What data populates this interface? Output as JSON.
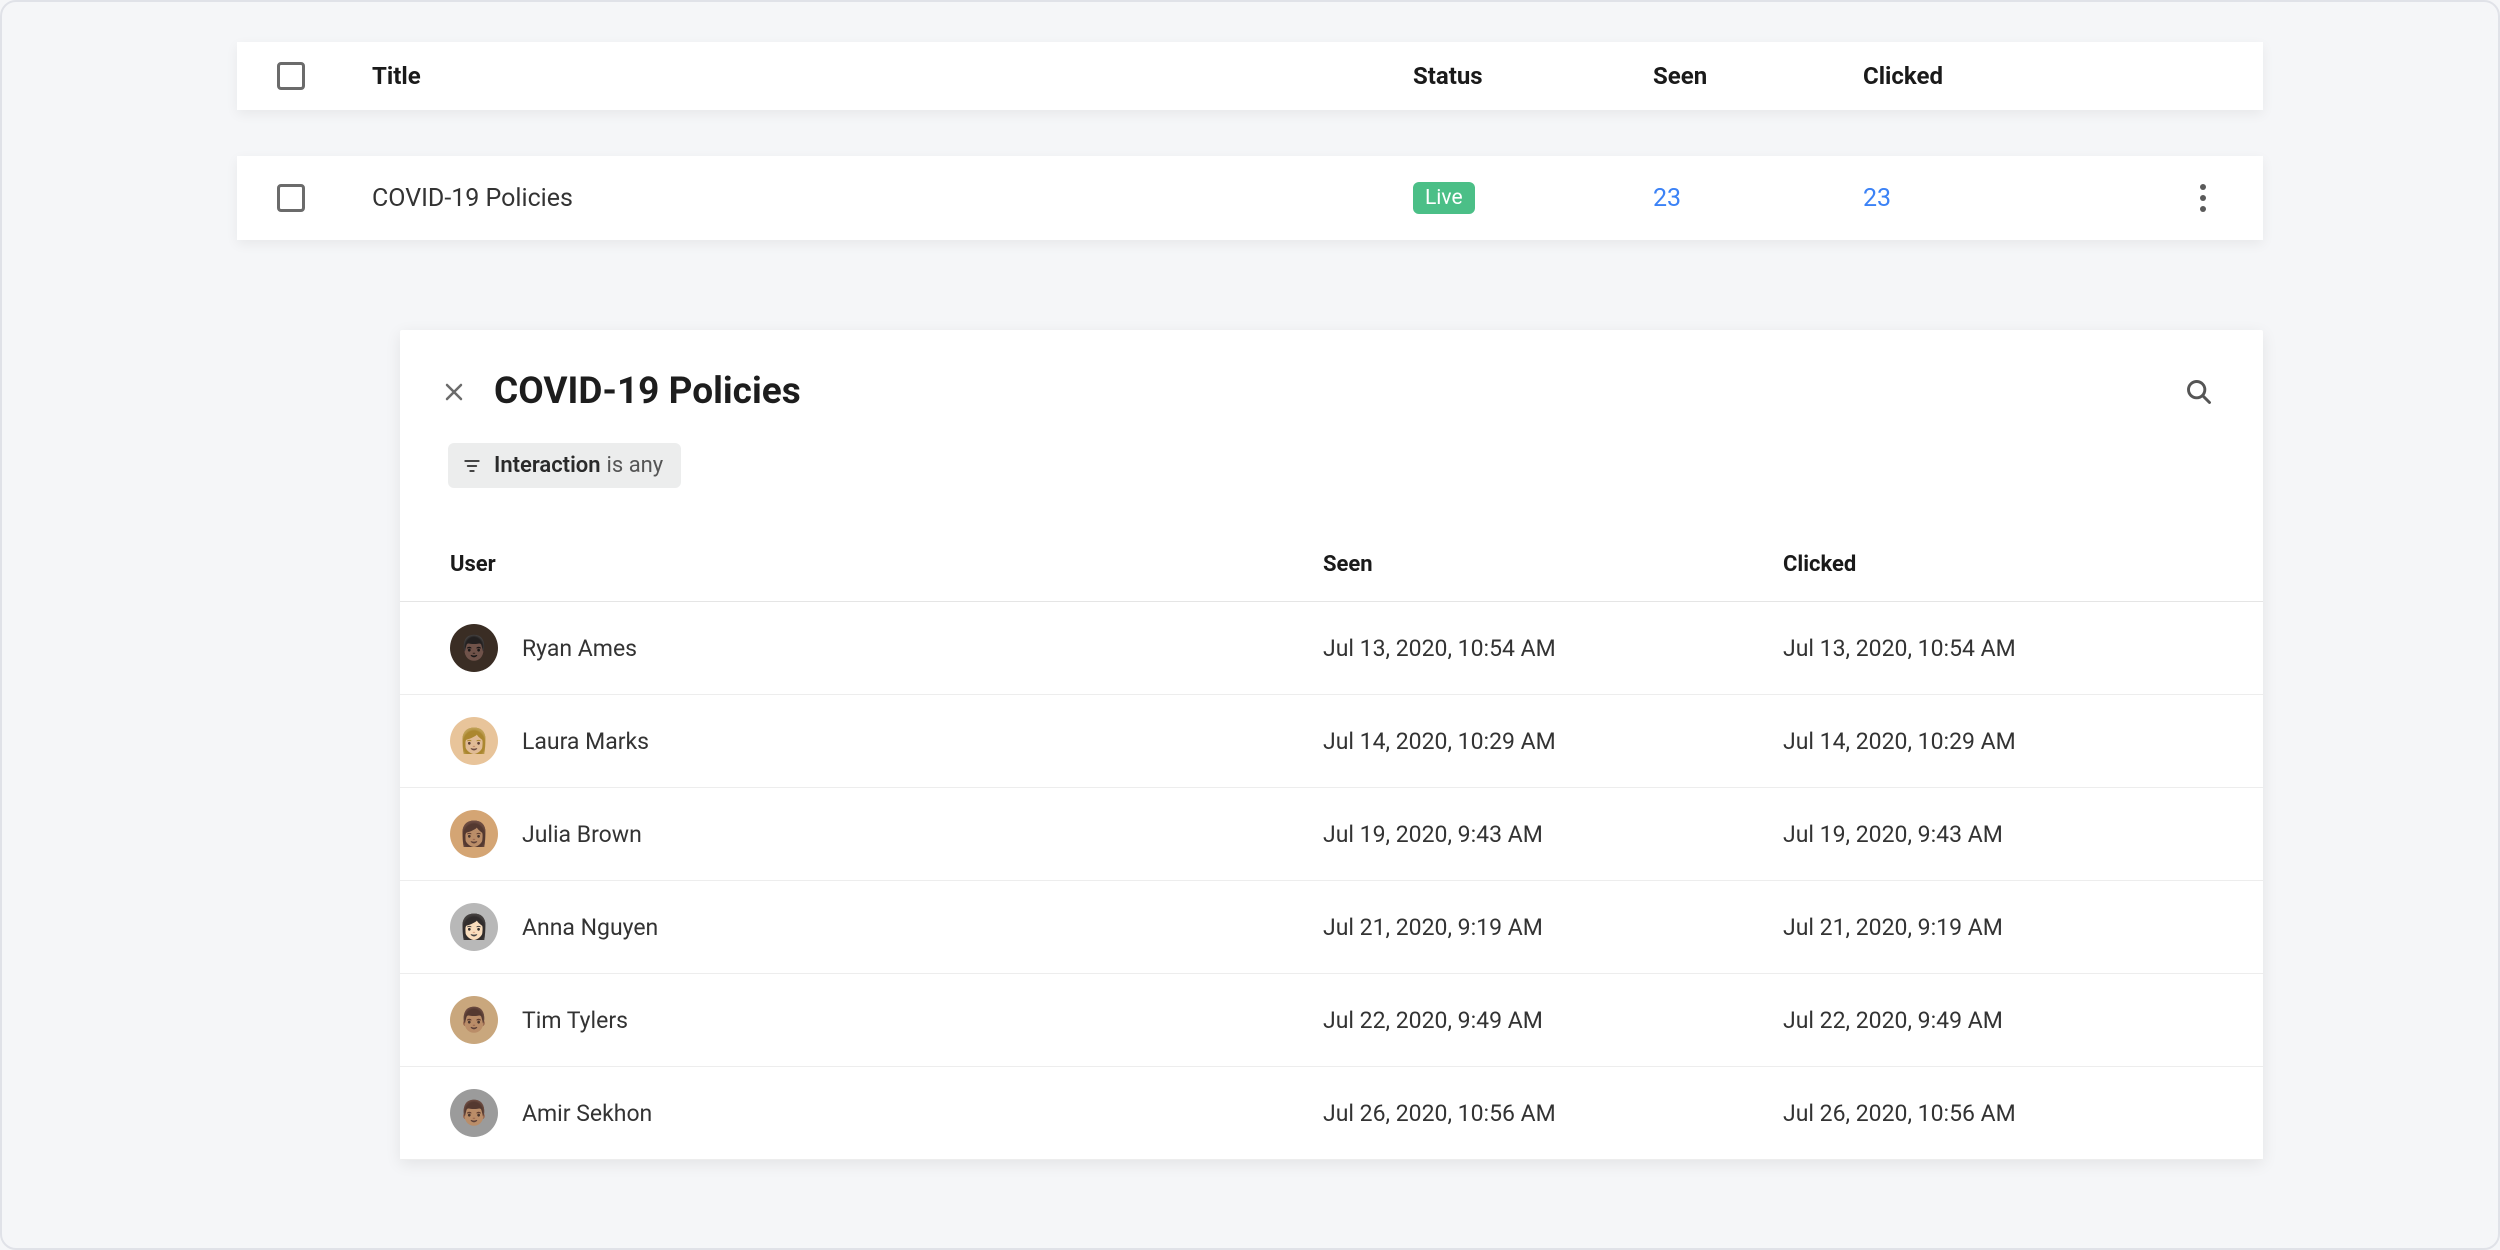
{
  "list": {
    "headers": {
      "title": "Title",
      "status": "Status",
      "seen": "Seen",
      "clicked": "Clicked"
    },
    "row": {
      "title": "COVID-19 Policies",
      "status": "Live",
      "status_color": "#4bbf87",
      "seen": "23",
      "clicked": "23"
    }
  },
  "detail": {
    "title": "COVID-19 Policies",
    "filter": {
      "label": "Interaction",
      "value": "is any"
    },
    "headers": {
      "user": "User",
      "seen": "Seen",
      "clicked": "Clicked"
    },
    "rows": [
      {
        "name": "Ryan Ames",
        "seen": "Jul 13, 2020, 10:54 AM",
        "clicked": "Jul 13, 2020, 10:54 AM",
        "avatar_bg": "#3a2d24",
        "avatar_emoji": "👨🏿"
      },
      {
        "name": "Laura Marks",
        "seen": "Jul 14, 2020, 10:29 AM",
        "clicked": "Jul 14, 2020, 10:29 AM",
        "avatar_bg": "#e8c49a",
        "avatar_emoji": "👩🏼"
      },
      {
        "name": "Julia Brown",
        "seen": "Jul 19, 2020, 9:43 AM",
        "clicked": "Jul 19, 2020, 9:43 AM",
        "avatar_bg": "#d4a574",
        "avatar_emoji": "👩🏽"
      },
      {
        "name": "Anna Nguyen",
        "seen": "Jul 21, 2020, 9:19 AM",
        "clicked": "Jul 21, 2020, 9:19 AM",
        "avatar_bg": "#b8b8b8",
        "avatar_emoji": "👩🏻"
      },
      {
        "name": "Tim Tylers",
        "seen": "Jul 22, 2020, 9:49 AM",
        "clicked": "Jul 22, 2020, 9:49 AM",
        "avatar_bg": "#c9a77d",
        "avatar_emoji": "👨🏽"
      },
      {
        "name": "Amir Sekhon",
        "seen": "Jul 26, 2020, 10:56 AM",
        "clicked": "Jul 26, 2020, 10:56 AM",
        "avatar_bg": "#9b9b9b",
        "avatar_emoji": "👨🏽"
      }
    ]
  }
}
